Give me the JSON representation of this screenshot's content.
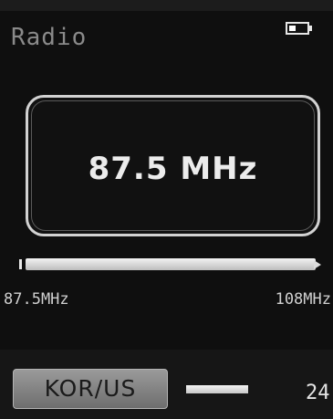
{
  "header": {
    "title": "Radio",
    "battery_icon": "battery-icon",
    "battery_level": 0.35
  },
  "tuner": {
    "frequency_display": "87.5 MHz",
    "frequency_value": 87.5,
    "range_min_label": "87.5MHz",
    "range_max_label": "108MHz",
    "position": 0.0
  },
  "footer": {
    "region_label": "KOR/US",
    "channel_number": "24"
  },
  "colors": {
    "background": "#0f0f0f",
    "text": "#e4e4e4",
    "title": "#8a8a8a",
    "region_button": "#8a8a8a"
  }
}
